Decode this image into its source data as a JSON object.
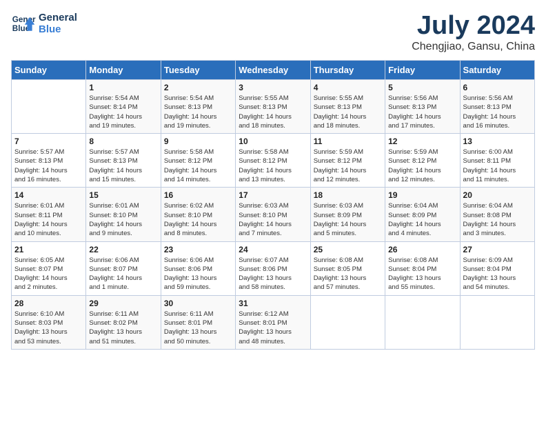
{
  "header": {
    "logo_line1": "General",
    "logo_line2": "Blue",
    "month": "July 2024",
    "location": "Chengjiao, Gansu, China"
  },
  "weekdays": [
    "Sunday",
    "Monday",
    "Tuesday",
    "Wednesday",
    "Thursday",
    "Friday",
    "Saturday"
  ],
  "weeks": [
    [
      {
        "day": "",
        "info": ""
      },
      {
        "day": "1",
        "info": "Sunrise: 5:54 AM\nSunset: 8:14 PM\nDaylight: 14 hours\nand 19 minutes."
      },
      {
        "day": "2",
        "info": "Sunrise: 5:54 AM\nSunset: 8:13 PM\nDaylight: 14 hours\nand 19 minutes."
      },
      {
        "day": "3",
        "info": "Sunrise: 5:55 AM\nSunset: 8:13 PM\nDaylight: 14 hours\nand 18 minutes."
      },
      {
        "day": "4",
        "info": "Sunrise: 5:55 AM\nSunset: 8:13 PM\nDaylight: 14 hours\nand 18 minutes."
      },
      {
        "day": "5",
        "info": "Sunrise: 5:56 AM\nSunset: 8:13 PM\nDaylight: 14 hours\nand 17 minutes."
      },
      {
        "day": "6",
        "info": "Sunrise: 5:56 AM\nSunset: 8:13 PM\nDaylight: 14 hours\nand 16 minutes."
      }
    ],
    [
      {
        "day": "7",
        "info": "Sunrise: 5:57 AM\nSunset: 8:13 PM\nDaylight: 14 hours\nand 16 minutes."
      },
      {
        "day": "8",
        "info": "Sunrise: 5:57 AM\nSunset: 8:13 PM\nDaylight: 14 hours\nand 15 minutes."
      },
      {
        "day": "9",
        "info": "Sunrise: 5:58 AM\nSunset: 8:12 PM\nDaylight: 14 hours\nand 14 minutes."
      },
      {
        "day": "10",
        "info": "Sunrise: 5:58 AM\nSunset: 8:12 PM\nDaylight: 14 hours\nand 13 minutes."
      },
      {
        "day": "11",
        "info": "Sunrise: 5:59 AM\nSunset: 8:12 PM\nDaylight: 14 hours\nand 12 minutes."
      },
      {
        "day": "12",
        "info": "Sunrise: 5:59 AM\nSunset: 8:12 PM\nDaylight: 14 hours\nand 12 minutes."
      },
      {
        "day": "13",
        "info": "Sunrise: 6:00 AM\nSunset: 8:11 PM\nDaylight: 14 hours\nand 11 minutes."
      }
    ],
    [
      {
        "day": "14",
        "info": "Sunrise: 6:01 AM\nSunset: 8:11 PM\nDaylight: 14 hours\nand 10 minutes."
      },
      {
        "day": "15",
        "info": "Sunrise: 6:01 AM\nSunset: 8:10 PM\nDaylight: 14 hours\nand 9 minutes."
      },
      {
        "day": "16",
        "info": "Sunrise: 6:02 AM\nSunset: 8:10 PM\nDaylight: 14 hours\nand 8 minutes."
      },
      {
        "day": "17",
        "info": "Sunrise: 6:03 AM\nSunset: 8:10 PM\nDaylight: 14 hours\nand 7 minutes."
      },
      {
        "day": "18",
        "info": "Sunrise: 6:03 AM\nSunset: 8:09 PM\nDaylight: 14 hours\nand 5 minutes."
      },
      {
        "day": "19",
        "info": "Sunrise: 6:04 AM\nSunset: 8:09 PM\nDaylight: 14 hours\nand 4 minutes."
      },
      {
        "day": "20",
        "info": "Sunrise: 6:04 AM\nSunset: 8:08 PM\nDaylight: 14 hours\nand 3 minutes."
      }
    ],
    [
      {
        "day": "21",
        "info": "Sunrise: 6:05 AM\nSunset: 8:07 PM\nDaylight: 14 hours\nand 2 minutes."
      },
      {
        "day": "22",
        "info": "Sunrise: 6:06 AM\nSunset: 8:07 PM\nDaylight: 14 hours\nand 1 minute."
      },
      {
        "day": "23",
        "info": "Sunrise: 6:06 AM\nSunset: 8:06 PM\nDaylight: 13 hours\nand 59 minutes."
      },
      {
        "day": "24",
        "info": "Sunrise: 6:07 AM\nSunset: 8:06 PM\nDaylight: 13 hours\nand 58 minutes."
      },
      {
        "day": "25",
        "info": "Sunrise: 6:08 AM\nSunset: 8:05 PM\nDaylight: 13 hours\nand 57 minutes."
      },
      {
        "day": "26",
        "info": "Sunrise: 6:08 AM\nSunset: 8:04 PM\nDaylight: 13 hours\nand 55 minutes."
      },
      {
        "day": "27",
        "info": "Sunrise: 6:09 AM\nSunset: 8:04 PM\nDaylight: 13 hours\nand 54 minutes."
      }
    ],
    [
      {
        "day": "28",
        "info": "Sunrise: 6:10 AM\nSunset: 8:03 PM\nDaylight: 13 hours\nand 53 minutes."
      },
      {
        "day": "29",
        "info": "Sunrise: 6:11 AM\nSunset: 8:02 PM\nDaylight: 13 hours\nand 51 minutes."
      },
      {
        "day": "30",
        "info": "Sunrise: 6:11 AM\nSunset: 8:01 PM\nDaylight: 13 hours\nand 50 minutes."
      },
      {
        "day": "31",
        "info": "Sunrise: 6:12 AM\nSunset: 8:01 PM\nDaylight: 13 hours\nand 48 minutes."
      },
      {
        "day": "",
        "info": ""
      },
      {
        "day": "",
        "info": ""
      },
      {
        "day": "",
        "info": ""
      }
    ]
  ]
}
